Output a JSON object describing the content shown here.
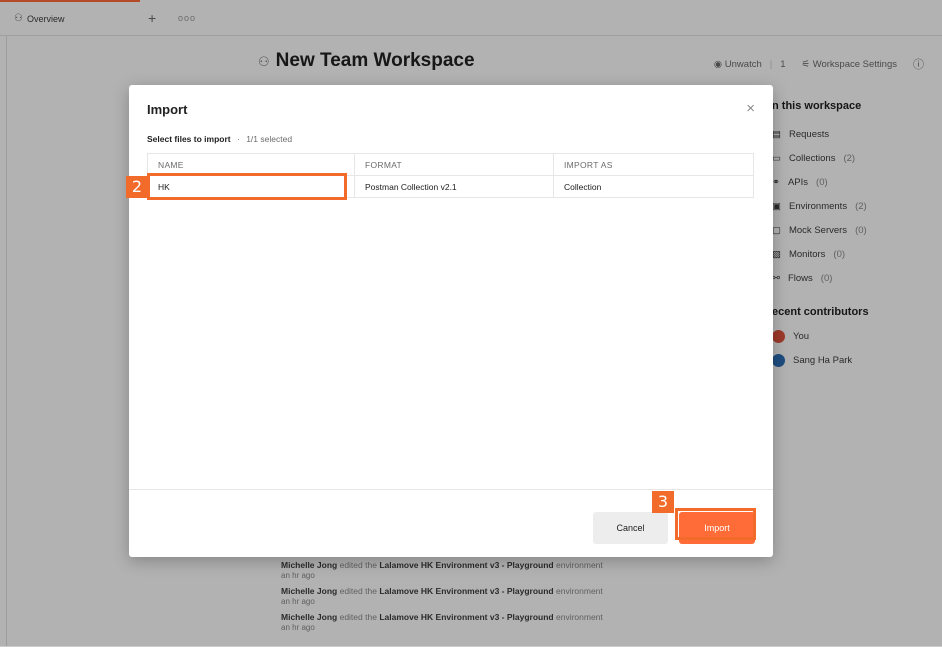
{
  "tabs": {
    "active_label": "Overview",
    "new_tab": "+",
    "more": "ooo"
  },
  "workspace": {
    "title": "New Team Workspace",
    "unwatch_label": "Unwatch",
    "watch_count": "1",
    "settings_label": "Workspace Settings",
    "info_icon": "ⓘ"
  },
  "sidebar": {
    "heading": "n this workspace",
    "items": [
      {
        "label": "Requests",
        "count": ""
      },
      {
        "label": "Collections",
        "count": "(2)"
      },
      {
        "label": "APIs",
        "count": "(0)"
      },
      {
        "label": "Environments",
        "count": "(2)"
      },
      {
        "label": "Mock Servers",
        "count": "(0)"
      },
      {
        "label": "Monitors",
        "count": "(0)"
      },
      {
        "label": "Flows",
        "count": "(0)"
      }
    ],
    "contributors_heading": "ecent contributors",
    "contributors": [
      "You",
      "Sang Ha Park"
    ]
  },
  "activity": [
    {
      "user": "Michelle Jong",
      "action": "edited the",
      "target": "Lalamove HK Environment v3 - Playground",
      "suffix": "environment",
      "time": "an hr ago"
    },
    {
      "user": "Michelle Jong",
      "action": "edited the",
      "target": "Lalamove HK Environment v3 - Playground",
      "suffix": "environment",
      "time": "an hr ago"
    },
    {
      "user": "Michelle Jong",
      "action": "edited the",
      "target": "Lalamove HK Environment v3 - Playground",
      "suffix": "environment",
      "time": "an hr ago"
    }
  ],
  "modal": {
    "title": "Import",
    "close_icon": "×",
    "select_label": "Select files to import",
    "separator": "·",
    "selected_count": "1/1 selected",
    "columns": [
      "NAME",
      "FORMAT",
      "IMPORT AS"
    ],
    "rows": [
      {
        "name": "HK",
        "format": "Postman Collection v2.1",
        "import_as": "Collection"
      }
    ],
    "cancel_label": "Cancel",
    "import_label": "Import"
  },
  "annotations": {
    "step_2": "2",
    "step_3": "3",
    "color": "#f26b2a"
  },
  "colors": {
    "accent": "#ff6c37"
  }
}
